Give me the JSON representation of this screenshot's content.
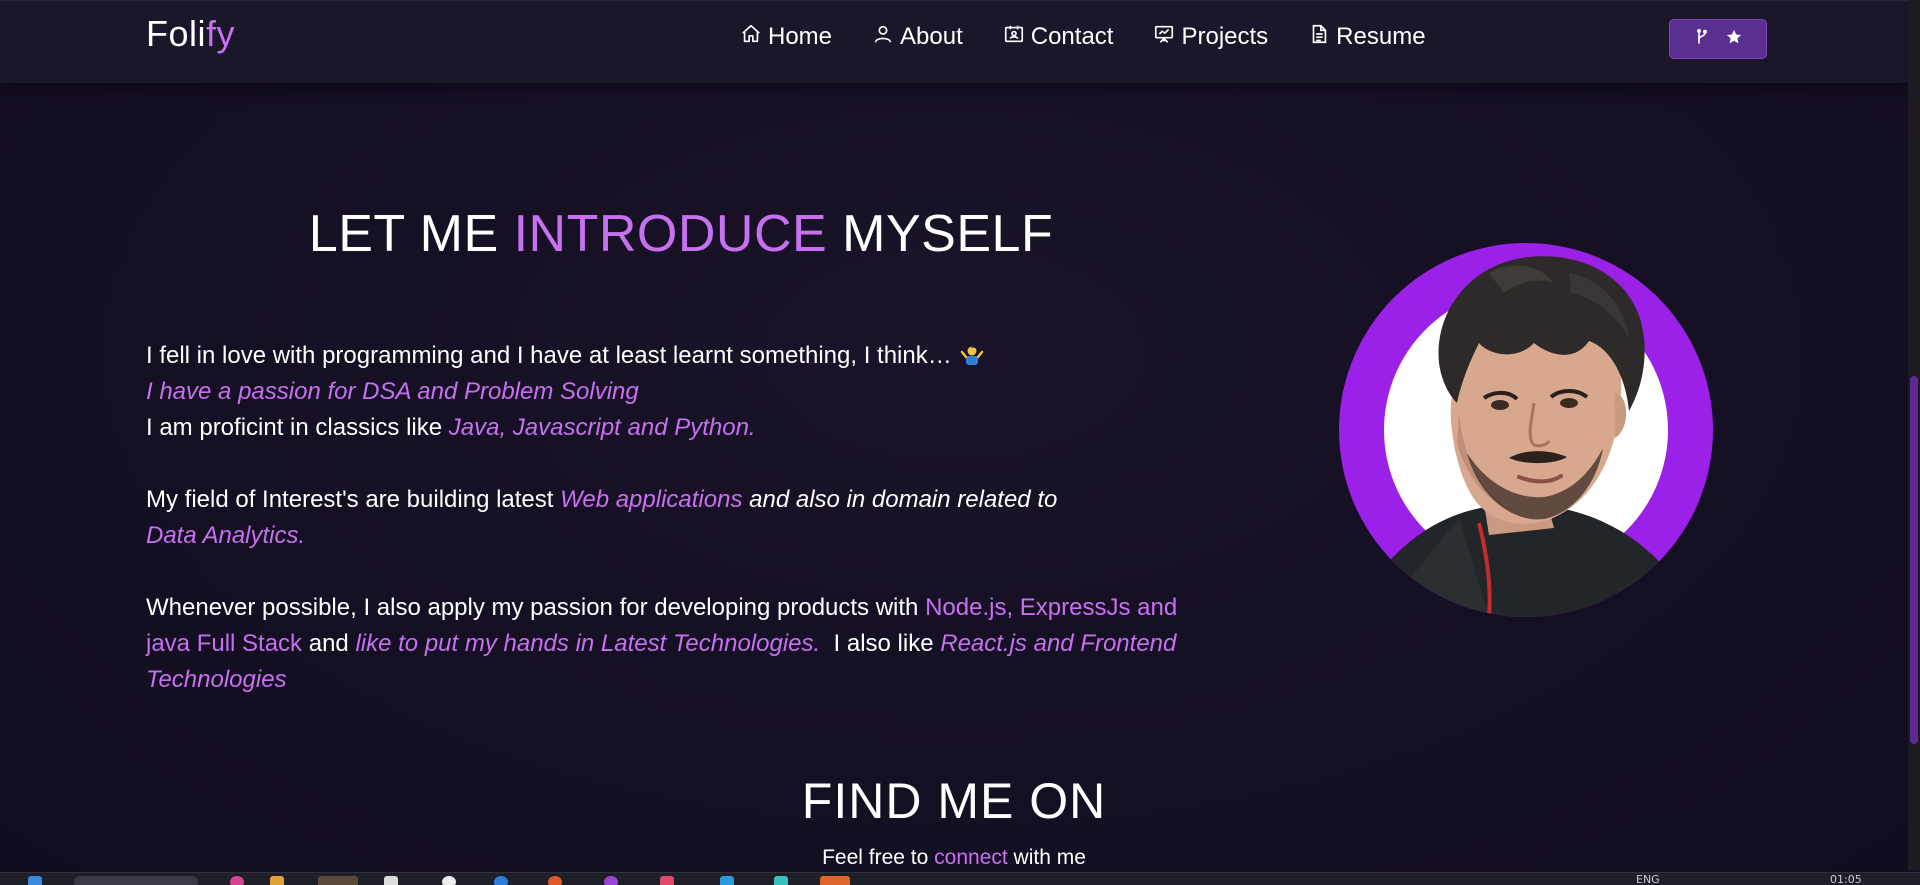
{
  "nav": {
    "brand_main": "Foli",
    "brand_accent": "fy",
    "items": [
      {
        "label": "Home",
        "icon": "home-icon"
      },
      {
        "label": "About",
        "icon": "user-icon"
      },
      {
        "label": "Contact",
        "icon": "contact-card-icon"
      },
      {
        "label": "Projects",
        "icon": "presentation-icon"
      },
      {
        "label": "Resume",
        "icon": "document-icon"
      }
    ],
    "fork_button_icons": [
      "git-fork-icon",
      "star-icon"
    ]
  },
  "intro": {
    "title_part1": "LET ME ",
    "title_accent": "INTRODUCE",
    "title_part2": " MYSELF",
    "p1_line1": "I fell in love with programming and I have at least learnt something, I think…",
    "p1_emoji": "shrugging-person-emoji",
    "p1_line2": "I have a passion for DSA and Problem Solving",
    "p1_line3_text": "I am proficint in classics like ",
    "p1_line3_accent": "Java, Javascript and Python.",
    "p2_text": "My field of Interest's are building latest ",
    "p2_accent": "Web applications",
    "p2_italic": " and also in domain related to ",
    "p2_accent2": "Data Analytics.",
    "p3_text": "Whenever possible, I also apply my passion for developing products with ",
    "p3_accent": "Node.js, ExpressJs and java Full Stack",
    "p3_and": " and ",
    "p3_italic_accent": "like to put my hands in Latest Technologies.",
    "p3_also": "  I also like ",
    "p3_italic_accent2": "React.js and Frontend Technologies"
  },
  "avatar": {
    "ring_color": "#9b21e8"
  },
  "find": {
    "title": "FIND ME ON",
    "sub_before": "Feel free to ",
    "sub_accent": "connect",
    "sub_after": " with me"
  },
  "taskbar": {
    "lang": "ENG",
    "time": "01:05"
  },
  "colors": {
    "accent": "#c770f0",
    "background": "#150f23",
    "navbar": "#1b1629",
    "button": "#5b2f8f"
  }
}
